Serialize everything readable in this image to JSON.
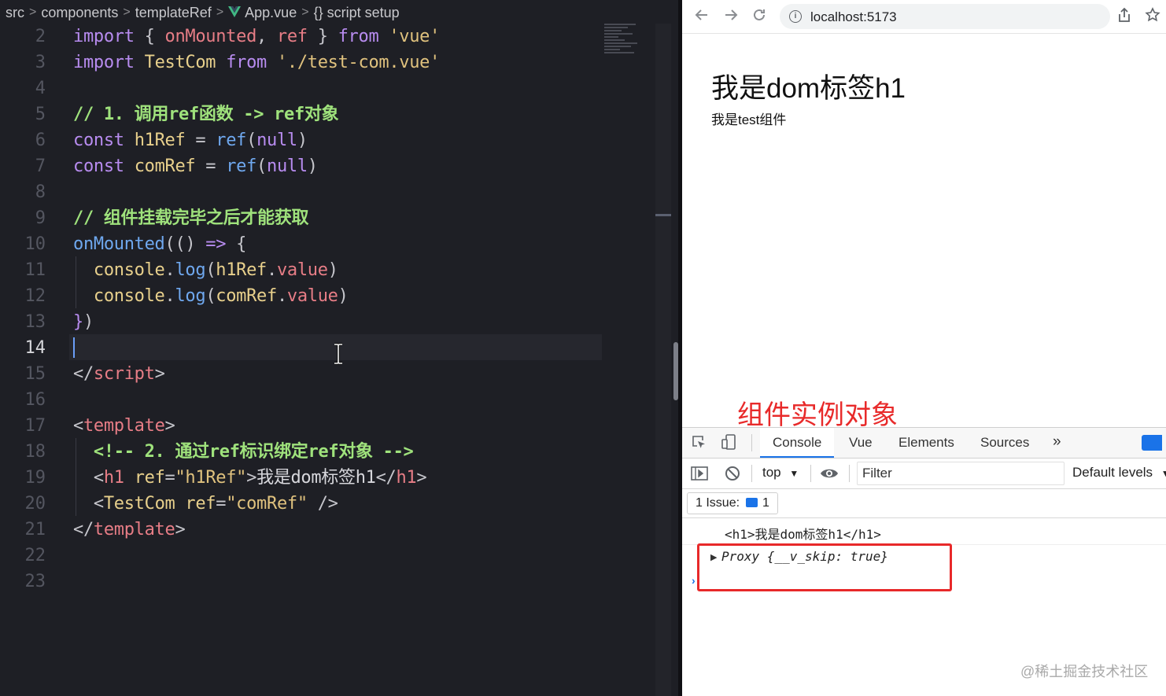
{
  "editor": {
    "breadcrumb": {
      "items": [
        "src",
        "components",
        "templateRef",
        "App.vue",
        "script setup"
      ],
      "separator": ">",
      "file_icon": "vue-logo-icon",
      "section_icon": "braces-icon"
    },
    "active_line": "14",
    "lines": [
      {
        "num": "2",
        "tokens": [
          [
            "kw",
            "import"
          ],
          [
            "punc",
            " { "
          ],
          [
            "prop",
            "onMounted"
          ],
          [
            "punc",
            ", "
          ],
          [
            "prop",
            "ref"
          ],
          [
            "punc",
            " } "
          ],
          [
            "kw",
            "from"
          ],
          [
            "punc",
            " "
          ],
          [
            "str",
            "'vue'"
          ]
        ]
      },
      {
        "num": "3",
        "tokens": [
          [
            "kw",
            "import"
          ],
          [
            "punc",
            " "
          ],
          [
            "var",
            "TestCom"
          ],
          [
            "punc",
            " "
          ],
          [
            "kw",
            "from"
          ],
          [
            "punc",
            " "
          ],
          [
            "str",
            "'./test-com.vue'"
          ]
        ]
      },
      {
        "num": "4",
        "tokens": []
      },
      {
        "num": "5",
        "tokens": [
          [
            "cm",
            "// 1. 调用ref函数 -> ref对象"
          ]
        ]
      },
      {
        "num": "6",
        "tokens": [
          [
            "kw",
            "const"
          ],
          [
            "punc",
            " "
          ],
          [
            "var",
            "h1Ref"
          ],
          [
            "punc",
            " = "
          ],
          [
            "fn",
            "ref"
          ],
          [
            "punc",
            "("
          ],
          [
            "kw",
            "null"
          ],
          [
            "punc",
            ")"
          ]
        ]
      },
      {
        "num": "7",
        "tokens": [
          [
            "kw",
            "const"
          ],
          [
            "punc",
            " "
          ],
          [
            "var",
            "comRef"
          ],
          [
            "punc",
            " = "
          ],
          [
            "fn",
            "ref"
          ],
          [
            "punc",
            "("
          ],
          [
            "kw",
            "null"
          ],
          [
            "punc",
            ")"
          ]
        ]
      },
      {
        "num": "8",
        "tokens": []
      },
      {
        "num": "9",
        "tokens": [
          [
            "cm",
            "// 组件挂载完毕之后才能获取"
          ]
        ]
      },
      {
        "num": "10",
        "tokens": [
          [
            "fn",
            "onMounted"
          ],
          [
            "punc",
            "(() "
          ],
          [
            "kw",
            "=>"
          ],
          [
            "punc",
            " {"
          ]
        ]
      },
      {
        "num": "11",
        "tokens": [
          [
            "plain",
            "  "
          ],
          [
            "var",
            "console"
          ],
          [
            "punc",
            "."
          ],
          [
            "fn",
            "log"
          ],
          [
            "punc",
            "("
          ],
          [
            "var",
            "h1Ref"
          ],
          [
            "punc",
            "."
          ],
          [
            "prop",
            "value"
          ],
          [
            "punc",
            ")"
          ]
        ]
      },
      {
        "num": "12",
        "tokens": [
          [
            "plain",
            "  "
          ],
          [
            "var",
            "console"
          ],
          [
            "punc",
            "."
          ],
          [
            "fn",
            "log"
          ],
          [
            "punc",
            "("
          ],
          [
            "var",
            "comRef"
          ],
          [
            "punc",
            "."
          ],
          [
            "prop",
            "value"
          ],
          [
            "punc",
            ")"
          ]
        ]
      },
      {
        "num": "13",
        "tokens": [
          [
            "kw",
            "}"
          ],
          [
            "punc",
            ")"
          ]
        ]
      },
      {
        "num": "14",
        "tokens": []
      },
      {
        "num": "15",
        "tokens": [
          [
            "punc",
            "</"
          ],
          [
            "tag",
            "script"
          ],
          [
            "punc",
            ">"
          ]
        ]
      },
      {
        "num": "16",
        "tokens": []
      },
      {
        "num": "17",
        "tokens": [
          [
            "punc",
            "<"
          ],
          [
            "tag",
            "template"
          ],
          [
            "punc",
            ">"
          ]
        ]
      },
      {
        "num": "18",
        "tokens": [
          [
            "plain",
            "  "
          ],
          [
            "cm",
            "<!-- 2. 通过ref标识绑定ref对象 -->"
          ]
        ]
      },
      {
        "num": "19",
        "tokens": [
          [
            "plain",
            "  "
          ],
          [
            "punc",
            "<"
          ],
          [
            "tag",
            "h1"
          ],
          [
            "punc",
            " "
          ],
          [
            "attr",
            "ref"
          ],
          [
            "punc",
            "="
          ],
          [
            "str",
            "\"h1Ref\""
          ],
          [
            "punc",
            ">"
          ],
          [
            "plain",
            "我是dom标签h1"
          ],
          [
            "punc",
            "</"
          ],
          [
            "tag",
            "h1"
          ],
          [
            "punc",
            ">"
          ]
        ]
      },
      {
        "num": "20",
        "tokens": [
          [
            "plain",
            "  "
          ],
          [
            "punc",
            "<"
          ],
          [
            "var",
            "TestCom"
          ],
          [
            "punc",
            " "
          ],
          [
            "attr",
            "ref"
          ],
          [
            "punc",
            "="
          ],
          [
            "str",
            "\"comRef\""
          ],
          [
            "punc",
            " />"
          ]
        ]
      },
      {
        "num": "21",
        "tokens": [
          [
            "punc",
            "</"
          ],
          [
            "tag",
            "template"
          ],
          [
            "punc",
            ">"
          ]
        ]
      },
      {
        "num": "22",
        "tokens": []
      },
      {
        "num": "23",
        "tokens": []
      }
    ]
  },
  "browser": {
    "url": "localhost:5173",
    "nav_icons": [
      "back-arrow-icon",
      "forward-arrow-icon",
      "reload-icon"
    ],
    "page": {
      "h1": "我是dom标签h1",
      "p": "我是test组件"
    },
    "annotation": "组件实例对象",
    "devtools": {
      "tabs": [
        "Console",
        "Vue",
        "Elements",
        "Sources"
      ],
      "more": "»",
      "active_tab": "Console",
      "context": "top",
      "filter_placeholder": "Filter",
      "levels": "Default levels",
      "issues_label": "1 Issue:",
      "issues_count": "1",
      "logs": [
        "<h1>我是dom标签h1</h1>",
        "Proxy {__v_skip: true}"
      ],
      "prompt": "›"
    },
    "watermark": "@稀土掘金技术社区"
  }
}
